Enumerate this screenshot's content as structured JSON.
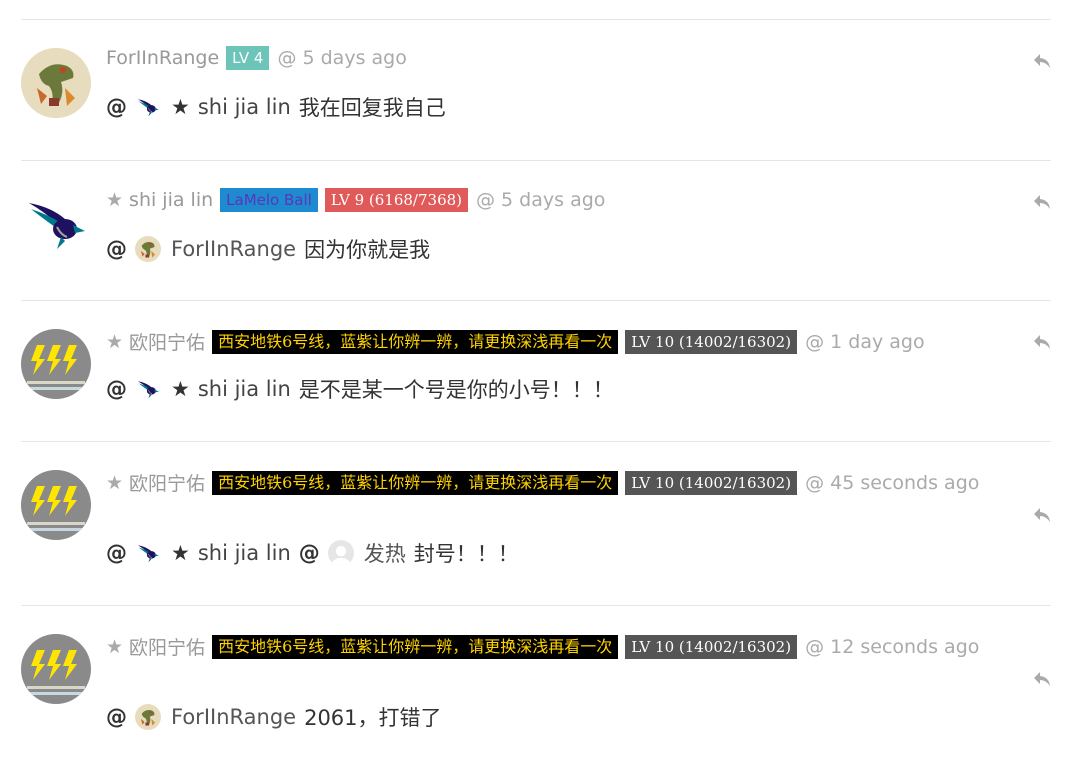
{
  "comments": [
    {
      "user": "ForIInRange",
      "level": "LV 4",
      "time": "@ 5 days ago",
      "mention": "shi jia lin",
      "text": "我在回复我自己"
    },
    {
      "user": "shi jia lin",
      "title": "LaMelo Ball",
      "level": "LV 9 (6168/7368)",
      "time": "@ 5 days ago",
      "mention": "ForIInRange",
      "text": "因为你就是我"
    },
    {
      "user": "欧阳宁佑",
      "title": "西安地铁6号线，蓝紫让你辨一辨，请更换深浅再看一次",
      "level": "LV 10 (14002/16302)",
      "time": "@ 1 day ago",
      "mention": "shi jia lin",
      "text": "是不是某一个号是你的小号！！！"
    },
    {
      "user": "欧阳宁佑",
      "title": "西安地铁6号线，蓝紫让你辨一辨，请更换深浅再看一次",
      "level": "LV 10 (14002/16302)",
      "time": "@ 45 seconds ago",
      "mention": "shi jia lin",
      "mention2": "发热",
      "text": "封号！！！"
    },
    {
      "user": "欧阳宁佑",
      "title": "西安地铁6号线，蓝紫让你辨一辨，请更换深浅再看一次",
      "level": "LV 10 (14002/16302)",
      "time": "@ 12 seconds ago",
      "mention": "ForIInRange",
      "text": "2061，打错了"
    }
  ],
  "at_symbol": "@",
  "star_glyph": "★",
  "colors": {
    "lv_teal": "#6cc5b8",
    "lv_red": "#e05a5a",
    "lv_dark": "#555555",
    "title_blue_bg": "#1e8bd0",
    "title_black_bg": "#000000",
    "title_yellow_text": "#ffd200"
  }
}
